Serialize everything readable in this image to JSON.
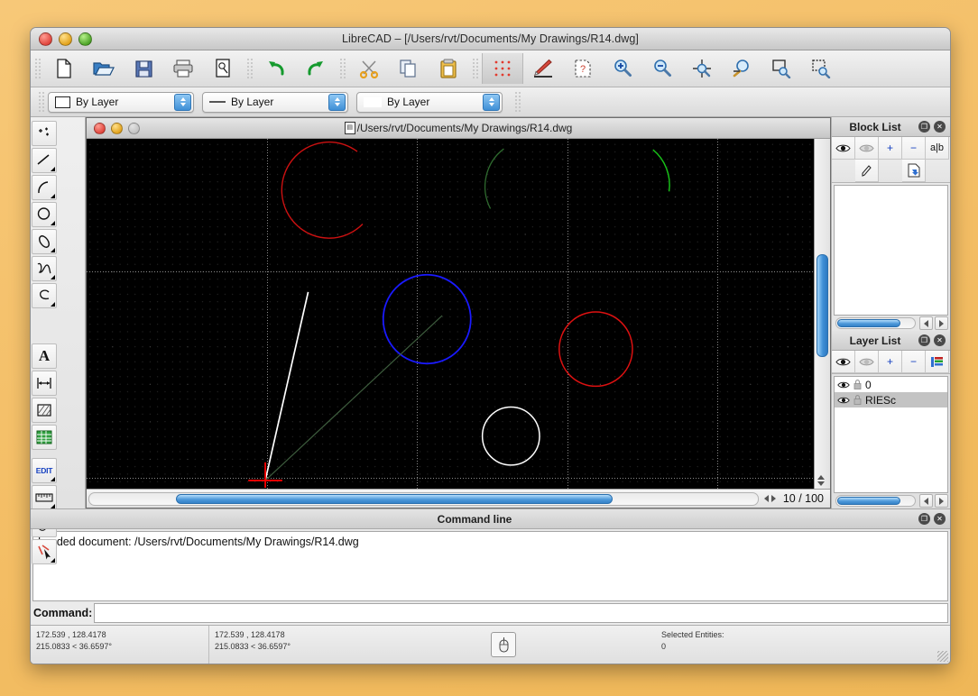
{
  "window": {
    "title": "LibreCAD – [/Users/rvt/Documents/My Drawings/R14.dwg]",
    "traffic": {
      "close": "close-button",
      "minimize": "minimize-button",
      "zoom": "zoom-button"
    }
  },
  "toolbar": {
    "buttons": [
      {
        "name": "new-file",
        "icon": "document-icon"
      },
      {
        "name": "open-file",
        "icon": "open-folder-icon"
      },
      {
        "name": "save-file",
        "icon": "floppy-disk-icon"
      },
      {
        "name": "print",
        "icon": "printer-icon"
      },
      {
        "name": "print-preview",
        "icon": "print-preview-icon"
      },
      {
        "name": "undo",
        "icon": "undo-arrow-icon"
      },
      {
        "name": "redo",
        "icon": "redo-arrow-icon"
      },
      {
        "name": "cut",
        "icon": "scissors-icon"
      },
      {
        "name": "copy",
        "icon": "copy-icon"
      },
      {
        "name": "paste",
        "icon": "clipboard-icon"
      },
      {
        "name": "toggle-grid",
        "icon": "grid-dots-icon",
        "active": true
      },
      {
        "name": "draw-pen",
        "icon": "red-pen-icon"
      },
      {
        "name": "snap-options",
        "icon": "snap-page-icon"
      },
      {
        "name": "zoom-in",
        "icon": "zoom-in-icon"
      },
      {
        "name": "zoom-out",
        "icon": "zoom-out-icon"
      },
      {
        "name": "zoom-auto",
        "icon": "zoom-auto-icon"
      },
      {
        "name": "zoom-pan",
        "icon": "zoom-pan-icon"
      },
      {
        "name": "zoom-window",
        "icon": "zoom-window-icon"
      },
      {
        "name": "zoom-previous",
        "icon": "zoom-previous-icon"
      }
    ]
  },
  "attributes": {
    "layer_combo": {
      "label": "By Layer",
      "swatch": "color-box"
    },
    "linewidth_combo": {
      "label": "By Layer",
      "swatch": "line-sample"
    },
    "linetype_combo": {
      "label": "By Layer",
      "swatch": "solid-sample"
    }
  },
  "toolpalette": {
    "tools": [
      {
        "name": "point-tool",
        "icon": "points-icon",
        "submenu": false
      },
      {
        "name": "line-tool",
        "icon": "line-icon",
        "submenu": true
      },
      {
        "name": "arc-tool",
        "icon": "arc-icon",
        "submenu": true
      },
      {
        "name": "circle-tool",
        "icon": "circle-icon",
        "submenu": true
      },
      {
        "name": "ellipse-tool",
        "icon": "ellipse-icon",
        "submenu": true
      },
      {
        "name": "spline-tool",
        "icon": "spline-icon",
        "submenu": true
      },
      {
        "name": "polyline-tool",
        "icon": "polyline-icon",
        "submenu": true
      },
      {
        "name": "text-tool",
        "icon": "letter-a-icon",
        "submenu": false,
        "label": "A"
      },
      {
        "name": "dimension-tool",
        "icon": "dimension-icon",
        "submenu": false
      },
      {
        "name": "hatch-tool",
        "icon": "hatch-icon",
        "submenu": false
      },
      {
        "name": "table-tool",
        "icon": "green-table-icon",
        "submenu": false
      },
      {
        "name": "modify-tool",
        "icon": "edit-icon",
        "submenu": true,
        "label": "EDIT"
      },
      {
        "name": "measure-tool",
        "icon": "ruler-icon",
        "submenu": true
      },
      {
        "name": "select-shapes-tool",
        "icon": "select-shapes-icon",
        "submenu": false
      },
      {
        "name": "pick-tool",
        "icon": "cursor-pick-icon",
        "submenu": true
      }
    ]
  },
  "child_window": {
    "title": "/Users/rvt/Documents/My Drawings/R14.dwg",
    "doc_icon": "document-icon"
  },
  "canvas": {
    "background": "#000000",
    "grid_dot_color": "#3c3c3c",
    "axis_color": "#8a8a8a",
    "cursor_color": "#ff0000",
    "entities": [
      {
        "type": "arc",
        "color": "#cc1111",
        "name": "red-arc"
      },
      {
        "type": "arc",
        "color": "#2f6b2f",
        "name": "dark-green-arc"
      },
      {
        "type": "arc",
        "color": "#18c018",
        "name": "bright-green-arc"
      },
      {
        "type": "circle",
        "color": "#1a1aff",
        "name": "blue-circle"
      },
      {
        "type": "circle",
        "color": "#dd1111",
        "name": "red-circle"
      },
      {
        "type": "circle",
        "color": "#ffffff",
        "name": "white-circle"
      },
      {
        "type": "line",
        "color": "#ffffff",
        "name": "white-line"
      },
      {
        "type": "line",
        "color": "#3d5c3d",
        "name": "green-line"
      }
    ]
  },
  "scroll": {
    "page_indicator": "10 / 100",
    "h_thumb_pct": 66,
    "v_thumb_pct": 28
  },
  "block_list": {
    "title": "Block List",
    "buttons": [
      {
        "name": "show-all-blocks",
        "icon": "eye-icon"
      },
      {
        "name": "hide-all-blocks",
        "icon": "eye-closed-icon"
      },
      {
        "name": "add-block",
        "icon": "plus-icon",
        "label": "+"
      },
      {
        "name": "remove-block",
        "icon": "minus-icon",
        "label": "−"
      },
      {
        "name": "rename-block",
        "icon": "rename-icon",
        "label": "a|b"
      },
      {
        "name": "edit-block",
        "icon": "pencil-icon"
      },
      {
        "name": "insert-block",
        "icon": "insert-page-icon"
      }
    ],
    "items": []
  },
  "layer_list": {
    "title": "Layer List",
    "buttons": [
      {
        "name": "show-all-layers",
        "icon": "eye-icon"
      },
      {
        "name": "hide-all-layers",
        "icon": "eye-closed-icon"
      },
      {
        "name": "add-layer",
        "icon": "plus-icon",
        "label": "+"
      },
      {
        "name": "remove-layer",
        "icon": "minus-icon",
        "label": "−"
      },
      {
        "name": "layer-settings",
        "icon": "color-bars-icon"
      }
    ],
    "items": [
      {
        "name": "0",
        "visible": true,
        "locked": false,
        "selected": false
      },
      {
        "name": "RIESc",
        "visible": true,
        "locked": false,
        "selected": true
      }
    ]
  },
  "command_line": {
    "title": "Command line",
    "output": "Loaded document: /Users/rvt/Documents/My Drawings/R14.dwg",
    "prompt_label": "Command:",
    "input_value": ""
  },
  "status_bar": {
    "absolute_coords": "172.539 , 128.4178",
    "absolute_polar": "215.0833 < 36.6597°",
    "relative_coords": "172.539 , 128.4178",
    "relative_polar": "215.0833 < 36.6597°",
    "mouse_icon": "mouse-icon",
    "selected_label": "Selected Entities:",
    "selected_count": "0"
  }
}
